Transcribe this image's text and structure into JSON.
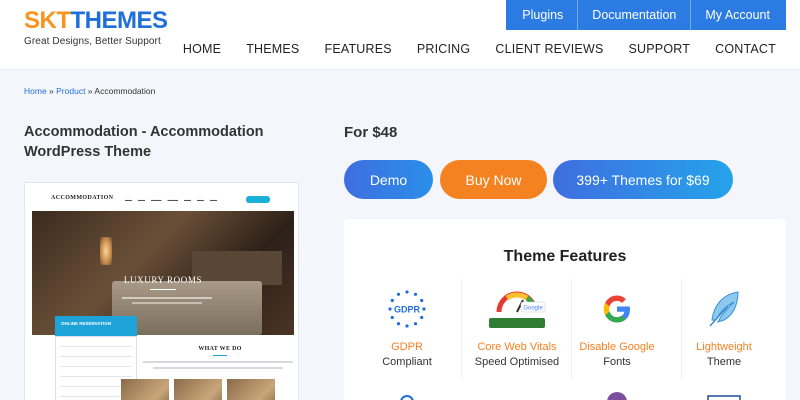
{
  "brand": {
    "logo_part1": "SKT",
    "logo_part2": "THEMES",
    "tagline": "Great Designs, Better Support"
  },
  "topbar": {
    "links": [
      "Plugins",
      "Documentation",
      "My Account"
    ]
  },
  "nav": {
    "links": [
      "HOME",
      "THEMES",
      "FEATURES",
      "PRICING",
      "CLIENT REVIEWS",
      "SUPPORT",
      "CONTACT"
    ]
  },
  "breadcrumb": {
    "home": "Home",
    "sep1": " » ",
    "product": "Product",
    "sep2": " » ",
    "current": "Accommodation"
  },
  "product": {
    "title": "Accommodation - Accommodation WordPress Theme",
    "price": "For $48"
  },
  "preview": {
    "logo": "ACCOMMODATION",
    "hero_title": "LUXURY ROOMS",
    "reservation_label": "ONLINE RESERVATION",
    "section_title": "WHAT WE DO"
  },
  "buttons": {
    "demo": "Demo",
    "buy": "Buy Now",
    "bundle": "399+ Themes for $69"
  },
  "features": {
    "title": "Theme Features",
    "items": [
      {
        "line1": "GDPR",
        "line2": "Compliant",
        "icon": "gdpr-icon"
      },
      {
        "line1": "Core Web Vitals",
        "line2": "Speed Optimised",
        "icon": "pagespeed-icon"
      },
      {
        "line1": "Disable Google",
        "line2": "Fonts",
        "icon": "google-icon"
      },
      {
        "line1": "Lightweight",
        "line2": "Theme",
        "icon": "feather-icon"
      }
    ]
  },
  "colors": {
    "accent_orange": "#f58220",
    "accent_blue": "#2b7be3"
  }
}
